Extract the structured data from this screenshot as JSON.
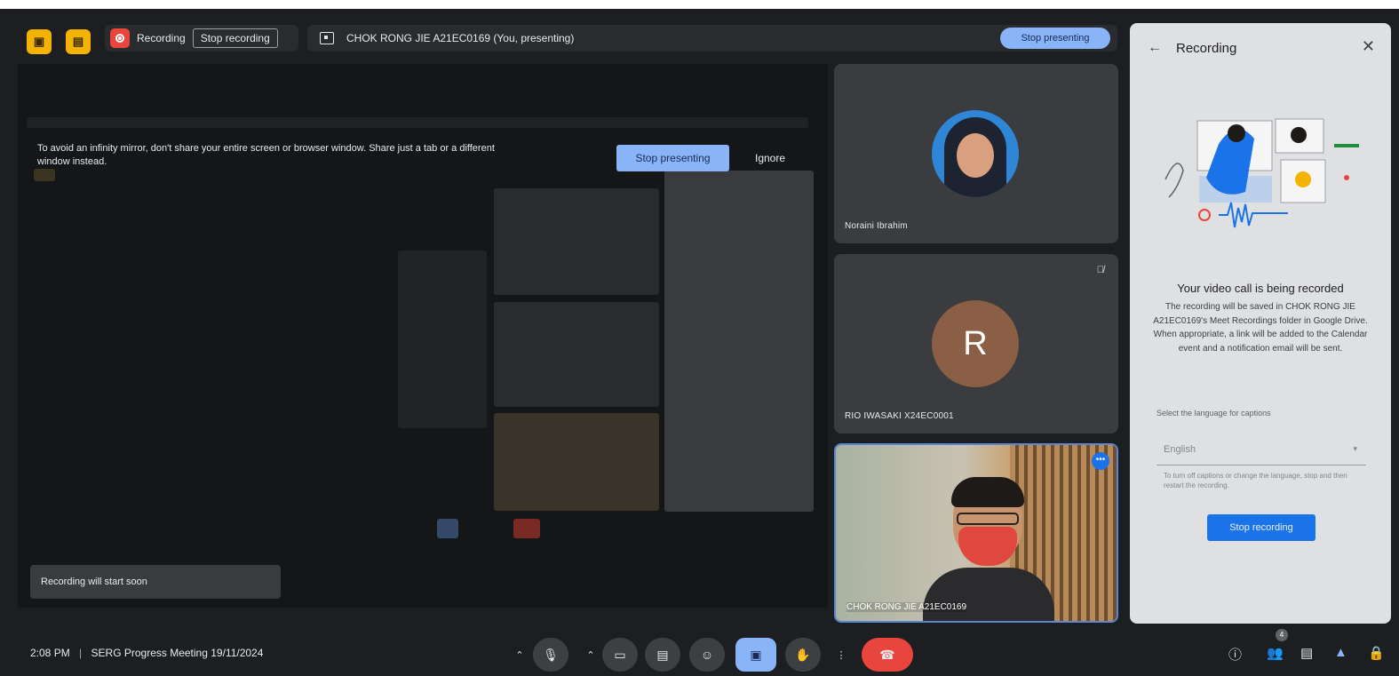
{
  "apps": {
    "icon1": "icon",
    "icon2": "icon"
  },
  "recording": {
    "label": "Recording",
    "stop_label": "Stop recording"
  },
  "presenting": {
    "label": "CHOK RONG JIE A21EC0169 (You, presenting)",
    "stop_label": "Stop presenting"
  },
  "share": {
    "warning": "To avoid an infinity mirror, don't share your entire screen or browser window. Share just a tab or a different window instead.",
    "stop_presenting": "Stop presenting",
    "ignore": "Ignore",
    "toast": "Recording will start soon"
  },
  "tiles": [
    {
      "name": "Noraini Ibrahim"
    },
    {
      "name": "RIO IWASAKI X24EC0001",
      "initial": "R"
    },
    {
      "name": "CHOK RONG JIE A21EC0169"
    }
  ],
  "panel": {
    "title": "Recording",
    "heading": "Your video call is being recorded",
    "body": "The recording will be saved in CHOK RONG JIE A21EC0169's Meet Recordings folder in Google Drive. When appropriate, a link will be added to the Calendar event and a notification email will be sent.",
    "lang_label": "Select the language for captions",
    "lang_value": "English",
    "lang_hint": "To turn off captions or change the language, stop and then restart the recording.",
    "stop_button": "Stop recording"
  },
  "bottom": {
    "time": "2:08 PM",
    "separator": "|",
    "meeting": "SERG Progress Meeting 19/11/2024",
    "people_count": "4"
  },
  "colors": {
    "accent": "#8ab4f8",
    "end_call": "#e8453c",
    "record": "#e8453c",
    "panel_button": "#1a73e8"
  }
}
